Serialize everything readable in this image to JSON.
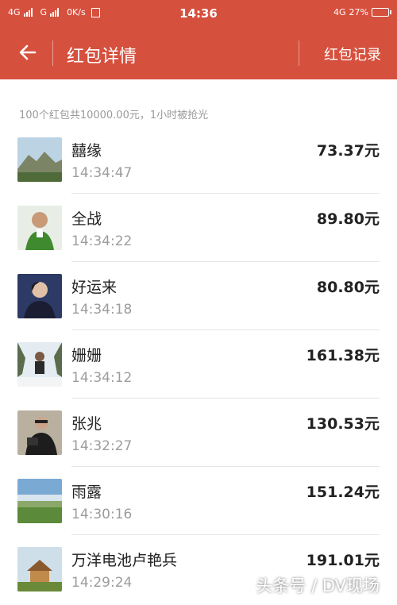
{
  "status_bar": {
    "net1": "4G",
    "net2": "G",
    "speed": "0K/s",
    "time": "14:36",
    "net3": "4G",
    "battery": "27%"
  },
  "header": {
    "title": "红包详情",
    "record": "红包记录",
    "back_icon": "arrow-left-icon",
    "color": "#d6503e"
  },
  "summary": "100个红包共10000.00元，1小时被抢光",
  "entries": [
    {
      "name": "囍缘",
      "time": "14:34:47",
      "amount": "73.37元"
    },
    {
      "name": "全战",
      "time": "14:34:22",
      "amount": "89.80元"
    },
    {
      "name": "好运来",
      "time": "14:34:18",
      "amount": "80.80元"
    },
    {
      "name": "姗姗",
      "time": "14:34:12",
      "amount": "161.38元"
    },
    {
      "name": "张兆",
      "time": "14:32:27",
      "amount": "130.53元"
    },
    {
      "name": "雨露",
      "time": "14:30:16",
      "amount": "151.24元"
    },
    {
      "name": "万洋电池卢艳兵",
      "time": "14:29:24",
      "amount": "191.01元"
    }
  ],
  "watermark": "头条号 / DV现场"
}
